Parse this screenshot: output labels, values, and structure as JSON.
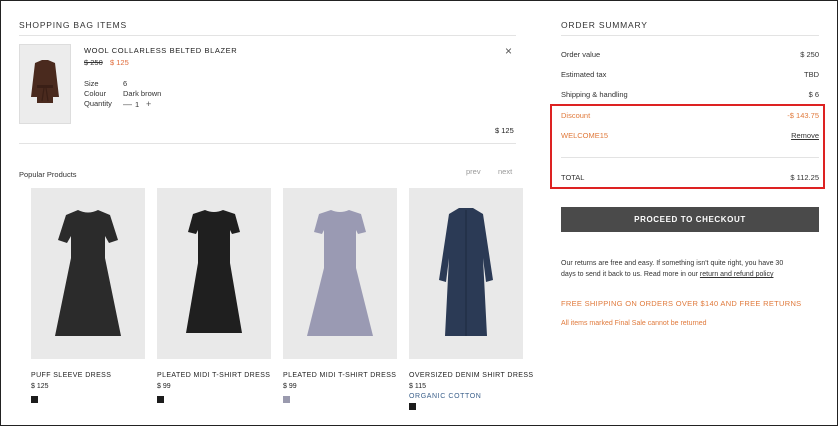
{
  "bag": {
    "title": "SHOPPING BAG ITEMS",
    "item": {
      "name": "WOOL COLLARLESS BELTED BLAZER",
      "price_old": "$ 250",
      "price_new": "$ 125",
      "size_label": "Size",
      "size_value": "6",
      "colour_label": "Colour",
      "colour_value": "Dark brown",
      "quantity_label": "Quantity",
      "quantity_value": "1",
      "qty_minus": "—",
      "qty_plus": "+",
      "close_icon": "×",
      "total": "$ 125"
    }
  },
  "popular": {
    "title": "Popular Products",
    "prev": "prev",
    "next": "next",
    "products": [
      {
        "name": "PUFF SLEEVE DRESS",
        "price": "$ 125",
        "swatch": "#1c1c1c",
        "dress_color": "#2b2b2b"
      },
      {
        "name": "PLEATED MIDI T-SHIRT DRESS",
        "price": "$ 99",
        "swatch": "#1c1c1c",
        "dress_color": "#1f1f1f"
      },
      {
        "name": "PLEATED MIDI T-SHIRT DRESS",
        "price": "$ 99",
        "swatch": "#9a9aae",
        "dress_color": "#9a9ab3"
      },
      {
        "name": "OVERSIZED DENIM SHIRT DRESS",
        "price": "$ 115",
        "tag": "ORGANIC COTTON",
        "swatch": "#1c1c1c",
        "dress_color": "#2b3a55"
      }
    ]
  },
  "summary": {
    "title": "ORDER SUMMARY",
    "order_value_label": "Order value",
    "order_value": "$ 250",
    "tax_label": "Estimated tax",
    "tax": "TBD",
    "shipping_label": "Shipping & handling",
    "shipping": "$ 6",
    "discount_label": "Discount",
    "discount": "-$ 143.75",
    "code": "WELCOME15",
    "remove": "Remove",
    "total_label": "TOTAL",
    "total": "$ 112.25",
    "checkout": "PROCEED TO CHECKOUT",
    "returns_1": "Our returns are free and easy. If something isn't quite right, you have 30",
    "returns_2": "days to send it back to us. Read more in our",
    "returns_link": "return and refund policy",
    "free_shipping": "FREE SHIPPING ON ORDERS OVER $140 AND FREE RETURNS",
    "final_sale": "All items marked Final Sale cannot be returned"
  },
  "colors": {
    "accent_orange": "#e07a3c",
    "highlight_red": "#dd2222",
    "button_dark": "#4a4a4a",
    "tag_blue": "#3a5f8a"
  }
}
